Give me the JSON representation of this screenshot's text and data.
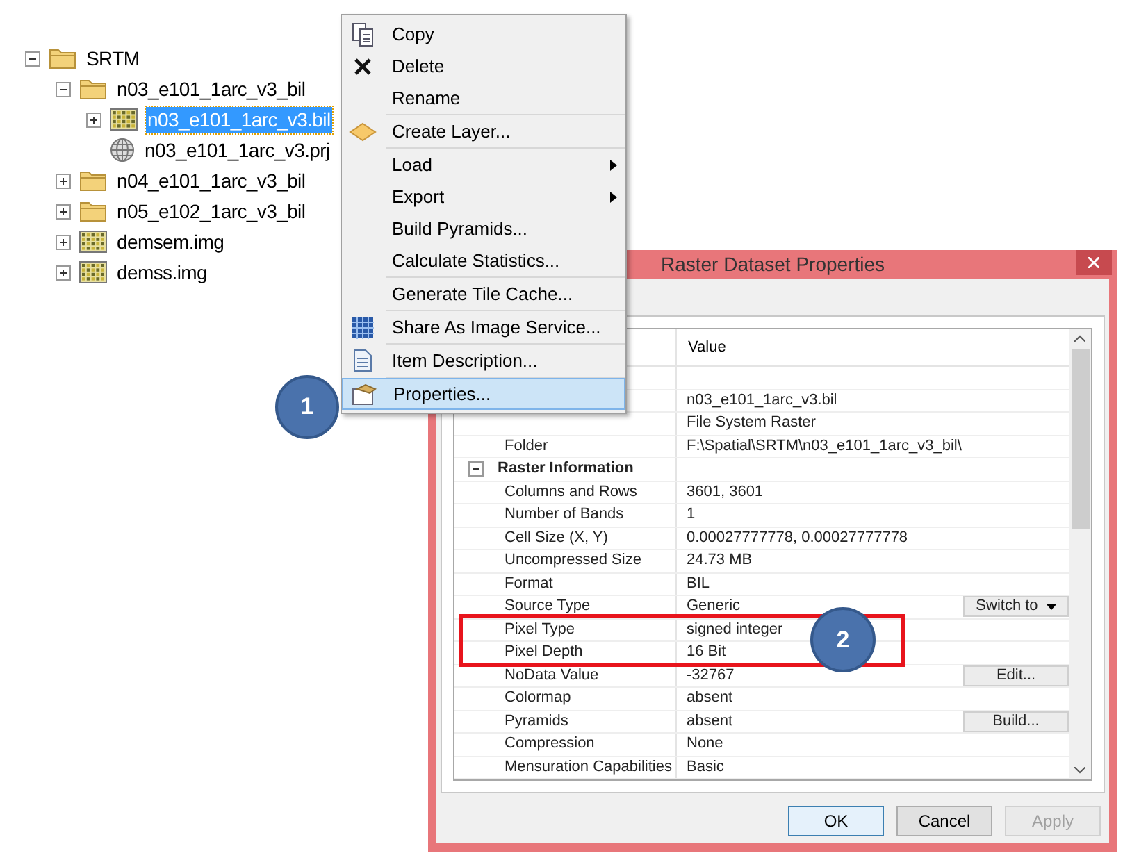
{
  "tree": [
    {
      "label": "SRTM",
      "kind": "folder",
      "expanded": true,
      "selected": false,
      "children": [
        {
          "label": "n03_e101_1arc_v3_bil",
          "kind": "folder",
          "expanded": true,
          "selected": false,
          "children": [
            {
              "label": "n03_e101_1arc_v3.bil",
              "kind": "raster",
              "expanded": false,
              "selected": true
            },
            {
              "label": "n03_e101_1arc_v3.prj",
              "kind": "projection",
              "selected": false
            }
          ]
        },
        {
          "label": "n04_e101_1arc_v3_bil",
          "kind": "folder",
          "expanded": false,
          "selected": false
        },
        {
          "label": "n05_e102_1arc_v3_bil",
          "kind": "folder",
          "expanded": false,
          "selected": false
        },
        {
          "label": "demsem.img",
          "kind": "raster",
          "expanded": false,
          "selected": false
        },
        {
          "label": "demss.img",
          "kind": "raster",
          "expanded": false,
          "selected": false
        }
      ]
    }
  ],
  "context_menu": {
    "groups": [
      [
        {
          "label": "Copy",
          "submenu": false,
          "selected": false
        },
        {
          "label": "Delete",
          "submenu": false,
          "selected": false
        },
        {
          "label": "Rename",
          "submenu": false,
          "selected": false
        }
      ],
      [
        {
          "label": "Create Layer...",
          "submenu": false,
          "selected": false
        }
      ],
      [
        {
          "label": "Load",
          "submenu": true,
          "selected": false
        },
        {
          "label": "Export",
          "submenu": true,
          "selected": false
        },
        {
          "label": "Build Pyramids...",
          "submenu": false,
          "selected": false
        },
        {
          "label": "Calculate Statistics...",
          "submenu": false,
          "selected": false
        }
      ],
      [
        {
          "label": "Generate Tile Cache...",
          "submenu": false,
          "selected": false
        }
      ],
      [
        {
          "label": "Share As Image Service...",
          "submenu": false,
          "selected": false
        }
      ],
      [
        {
          "label": "Item Description...",
          "submenu": false,
          "selected": false
        }
      ],
      [
        {
          "label": "Properties...",
          "submenu": false,
          "selected": true
        }
      ]
    ]
  },
  "dialog": {
    "title": "Raster Dataset Properties",
    "value_header": "Value",
    "rows": [
      {
        "kind": "property"
      },
      {
        "kind": "property",
        "value": "n03_e101_1arc_v3.bil"
      },
      {
        "kind": "property",
        "value": "File System Raster"
      },
      {
        "kind": "property",
        "name": "Folder",
        "value": "F:\\Spatial\\SRTM\\n03_e101_1arc_v3_bil\\"
      },
      {
        "kind": "category",
        "name": "Raster Information",
        "expanded": true
      },
      {
        "kind": "property",
        "name": "Columns and Rows",
        "value": "3601, 3601"
      },
      {
        "kind": "property",
        "name": "Number of Bands",
        "value": "1"
      },
      {
        "kind": "property",
        "name": "Cell Size (X, Y)",
        "value": "0.00027777778, 0.00027777778"
      },
      {
        "kind": "property",
        "name": "Uncompressed Size",
        "value": "24.73 MB"
      },
      {
        "kind": "property",
        "name": "Format",
        "value": "BIL"
      },
      {
        "kind": "property",
        "name": "Source Type",
        "value": "Generic",
        "button": {
          "label": "Switch to",
          "dropdown": true
        }
      },
      {
        "kind": "property",
        "name": "Pixel Type",
        "value": "signed integer"
      },
      {
        "kind": "property",
        "name": "Pixel Depth",
        "value": "16 Bit"
      },
      {
        "kind": "property",
        "name": "NoData Value",
        "value": "-32767",
        "button": {
          "label": "Edit...",
          "dropdown": false
        }
      },
      {
        "kind": "property",
        "name": "Colormap",
        "value": "absent"
      },
      {
        "kind": "property",
        "name": "Pyramids",
        "value": "absent",
        "button": {
          "label": "Build...",
          "dropdown": false
        }
      },
      {
        "kind": "property",
        "name": "Compression",
        "value": "None"
      },
      {
        "kind": "property",
        "name": "Mensuration Capabilities",
        "value": "Basic"
      }
    ],
    "buttons": [
      {
        "label": "OK",
        "default": true,
        "disabled": false
      },
      {
        "label": "Cancel",
        "default": false,
        "disabled": false
      },
      {
        "label": "Apply",
        "default": false,
        "disabled": true
      }
    ]
  },
  "callouts": [
    "1",
    "2"
  ]
}
